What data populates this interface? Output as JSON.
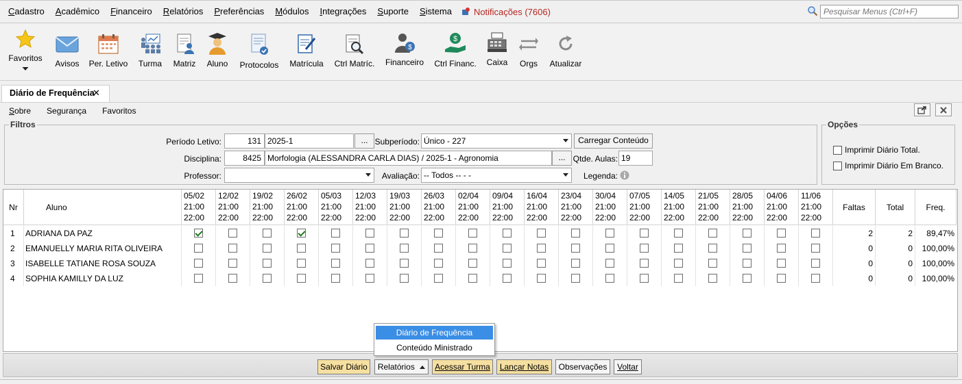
{
  "menu": {
    "items": [
      {
        "name": "menu-cadastro",
        "u": "C",
        "rest": "adastro"
      },
      {
        "name": "menu-academico",
        "u": "A",
        "rest": "cadêmico"
      },
      {
        "name": "menu-financeiro",
        "u": "F",
        "rest": "inanceiro"
      },
      {
        "name": "menu-relatorios",
        "u": "R",
        "rest": "elatórios"
      },
      {
        "name": "menu-preferencias",
        "u": "P",
        "rest": "referências"
      },
      {
        "name": "menu-modulos",
        "u": "M",
        "rest": "ódulos"
      },
      {
        "name": "menu-integracoes",
        "u": "I",
        "rest": "ntegrações"
      },
      {
        "name": "menu-suporte",
        "u": "S",
        "rest": "uporte"
      },
      {
        "name": "menu-sistema",
        "u": "S",
        "rest": "istema"
      }
    ],
    "notifications": "Notificações (7606)",
    "search_placeholder": "Pesquisar Menus (Ctrl+F)"
  },
  "toolbar": {
    "favoritos": "Favoritos",
    "avisos": "Avisos",
    "per_letivo": "Per. Letivo",
    "turma": "Turma",
    "matriz": "Matriz",
    "aluno": "Aluno",
    "protocolos": "Protocolos",
    "matricula": "Matrícula",
    "ctrl_matric": "Ctrl Matríc.",
    "financeiro": "Financeiro",
    "ctrl_financ": "Ctrl Financ.",
    "caixa": "Caixa",
    "orgs": "Orgs",
    "atualizar": "Atualizar"
  },
  "tab": {
    "title": "Diário de Frequência",
    "close": "✕"
  },
  "submenu": {
    "sobre_u": "S",
    "sobre_rest": "obre",
    "seguranca": "Segurança",
    "favoritos": "Favoritos"
  },
  "filtros": {
    "legend": "Filtros",
    "periodo_label": "Período Letivo:",
    "periodo_code": "131",
    "periodo_value": "2025-1",
    "ellipsis": "...",
    "subperiodo_label": "Subperíodo:",
    "subperiodo_value": "Único - 227",
    "carregar": "Carregar Conteúdo",
    "disciplina_label": "Disciplina:",
    "disciplina_code": "8425",
    "disciplina_value": "Morfologia  (ALESSANDRA CARLA DIAS) / 2025-1 - Agronomia",
    "qtde_label": "Qtde. Aulas:",
    "qtde_value": "19",
    "professor_label": "Professor:",
    "professor_value": "",
    "avaliacao_label": "Avaliação:",
    "avaliacao_value": "-- Todos -- -  -",
    "legenda_label": "Legenda:"
  },
  "opcoes": {
    "legend": "Opções",
    "imprimir_total": "Imprimir Diário Total.",
    "imprimir_branco": "Imprimir Diário Em Branco."
  },
  "grid": {
    "col_nr": "Nr",
    "col_aluno": "Aluno",
    "col_faltas": "Faltas",
    "col_total": "Total",
    "col_freq": "Freq.",
    "time_start": "21:00",
    "time_end": "22:00",
    "dates": [
      "05/02",
      "12/02",
      "19/02",
      "26/02",
      "05/03",
      "12/03",
      "19/03",
      "26/03",
      "02/04",
      "09/04",
      "16/04",
      "23/04",
      "30/04",
      "07/05",
      "14/05",
      "21/05",
      "28/05",
      "04/06",
      "11/06"
    ],
    "rows": [
      {
        "nr": "1",
        "aluno": "ADRIANA DA PAZ",
        "checked": [
          0,
          3
        ],
        "faltas": "2",
        "total": "2",
        "freq": "89,47%"
      },
      {
        "nr": "2",
        "aluno": "EMANUELLY MARIA RITA OLIVEIRA",
        "checked": [],
        "faltas": "0",
        "total": "0",
        "freq": "100,00%"
      },
      {
        "nr": "3",
        "aluno": "ISABELLE TATIANE ROSA SOUZA",
        "checked": [],
        "faltas": "0",
        "total": "0",
        "freq": "100,00%"
      },
      {
        "nr": "4",
        "aluno": "SOPHIA KAMILLY DA LUZ",
        "checked": [],
        "faltas": "0",
        "total": "0",
        "freq": "100,00%"
      }
    ]
  },
  "popup": {
    "item1": "Diário de Frequência",
    "item2": "Conteúdo Ministrado"
  },
  "bottom": {
    "salvar": "Salvar Diário",
    "relatorios": "Relatórios",
    "acessar_turma": "Acessar Turma",
    "lancar_notas": "Lançar Notas",
    "observacoes": "Observações",
    "voltar": "Voltar"
  }
}
